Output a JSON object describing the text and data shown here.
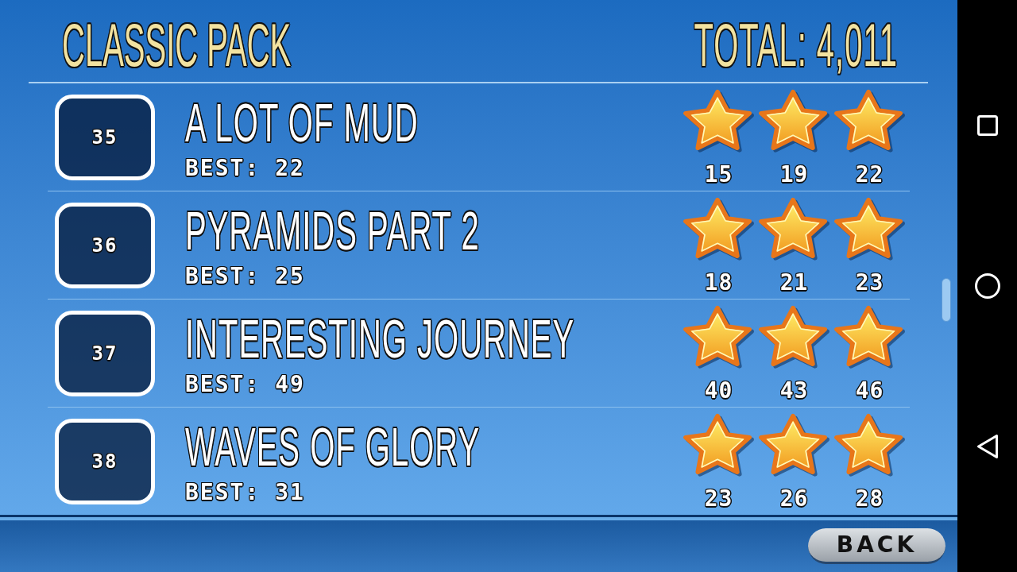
{
  "header": {
    "title": "CLASSIC PACK",
    "total": "TOTAL: 4,011"
  },
  "levels": [
    {
      "number": "35",
      "title": "A LOT OF MUD",
      "best": "BEST: 22",
      "stars": 3,
      "thresholds": [
        "15",
        "19",
        "22"
      ]
    },
    {
      "number": "36",
      "title": "PYRAMIDS PART 2",
      "best": "BEST: 25",
      "stars": 3,
      "thresholds": [
        "18",
        "21",
        "23"
      ]
    },
    {
      "number": "37",
      "title": "INTERESTING JOURNEY",
      "best": "BEST: 49",
      "stars": 3,
      "thresholds": [
        "40",
        "43",
        "46"
      ]
    },
    {
      "number": "38",
      "title": "WAVES OF GLORY",
      "best": "BEST: 31",
      "stars": 3,
      "thresholds": [
        "23",
        "26",
        "28"
      ]
    }
  ],
  "back_button": {
    "label": "BACK"
  }
}
